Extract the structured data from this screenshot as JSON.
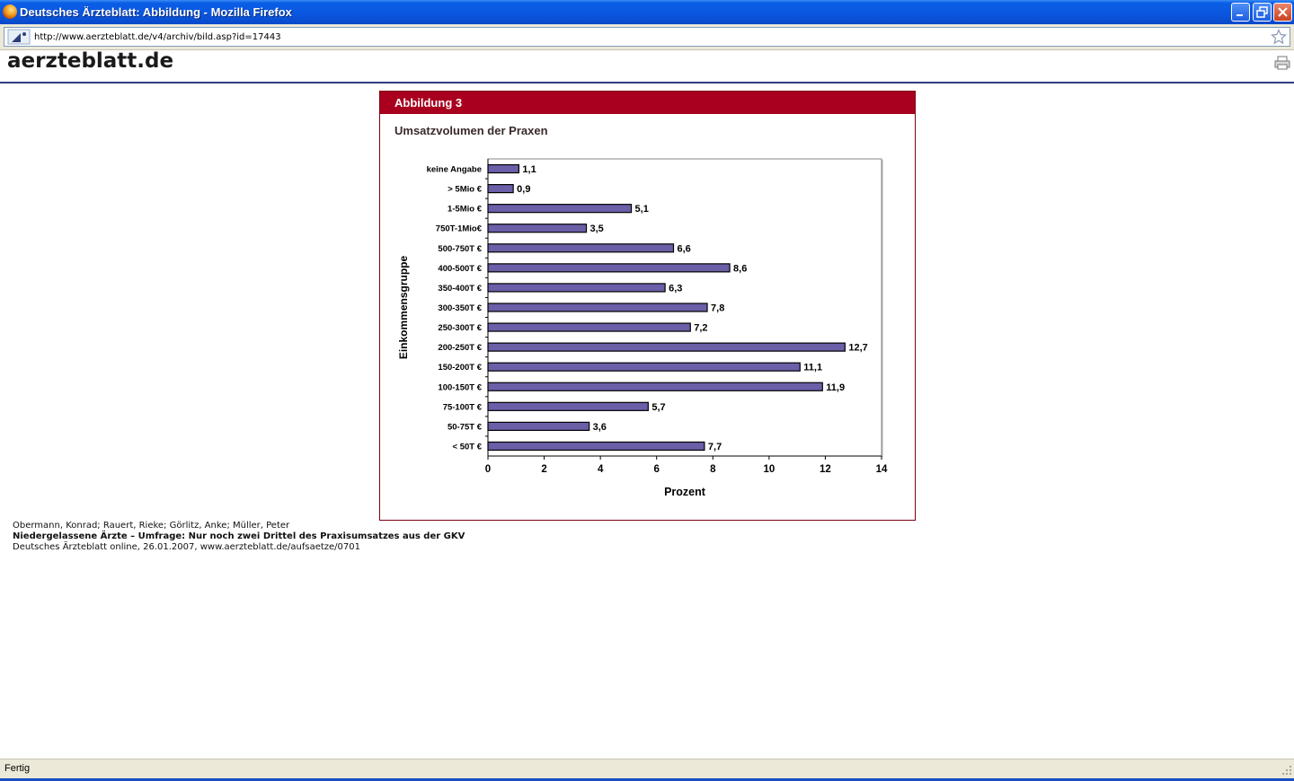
{
  "window": {
    "title": "Deutsches Ärzteblatt: Abbildung - Mozilla Firefox",
    "url": "http://www.aerzteblatt.de/v4/archiv/bild.asp?id=17443"
  },
  "page": {
    "logo": "aerzteblatt.de",
    "figure_label": "Abbildung 3",
    "figure_title": "Umsatzvolumen der Praxen"
  },
  "citation": {
    "authors": "Obermann, Konrad; Rauert, Rieke; Görlitz, Anke; Müller, Peter",
    "title": "Niedergelassene Ärzte – Umfrage: Nur noch zwei Drittel des Praxisumsatzes aus der GKV",
    "source": "Deutsches Ärzteblatt online, 26.01.2007, www.aerzteblatt.de/aufsaetze/0701"
  },
  "status": {
    "text": "Fertig"
  },
  "icons": {
    "app": "firefox-icon",
    "site": "site-identity-icon",
    "bookmark": "star-icon",
    "print": "print-icon"
  },
  "chart_data": {
    "type": "bar",
    "orientation": "horizontal",
    "categories": [
      "keine Angabe",
      "> 5Mio €",
      "1-5Mio €",
      "750T-1Mio€",
      "500-750T €",
      "400-500T €",
      "350-400T €",
      "300-350T €",
      "250-300T €",
      "200-250T €",
      "150-200T €",
      "100-150T €",
      "75-100T €",
      "50-75T €",
      "< 50T €"
    ],
    "values": [
      1.1,
      0.9,
      5.1,
      3.5,
      6.6,
      8.6,
      6.3,
      7.8,
      7.2,
      12.7,
      11.1,
      11.9,
      5.7,
      3.6,
      7.7
    ],
    "value_labels": [
      "1,1",
      "0,9",
      "5,1",
      "3,5",
      "6,6",
      "8,6",
      "6,3",
      "7,8",
      "7,2",
      "12,7",
      "11,1",
      "11,9",
      "5,7",
      "3,6",
      "7,7"
    ],
    "xlabel": "Prozent",
    "ylabel": "Einkommensgruppe",
    "xlim": [
      0,
      14
    ],
    "xticks": [
      "0",
      "2",
      "4",
      "6",
      "8",
      "10",
      "12",
      "14"
    ],
    "grid": false,
    "bar_color": "#6b5fa8"
  }
}
